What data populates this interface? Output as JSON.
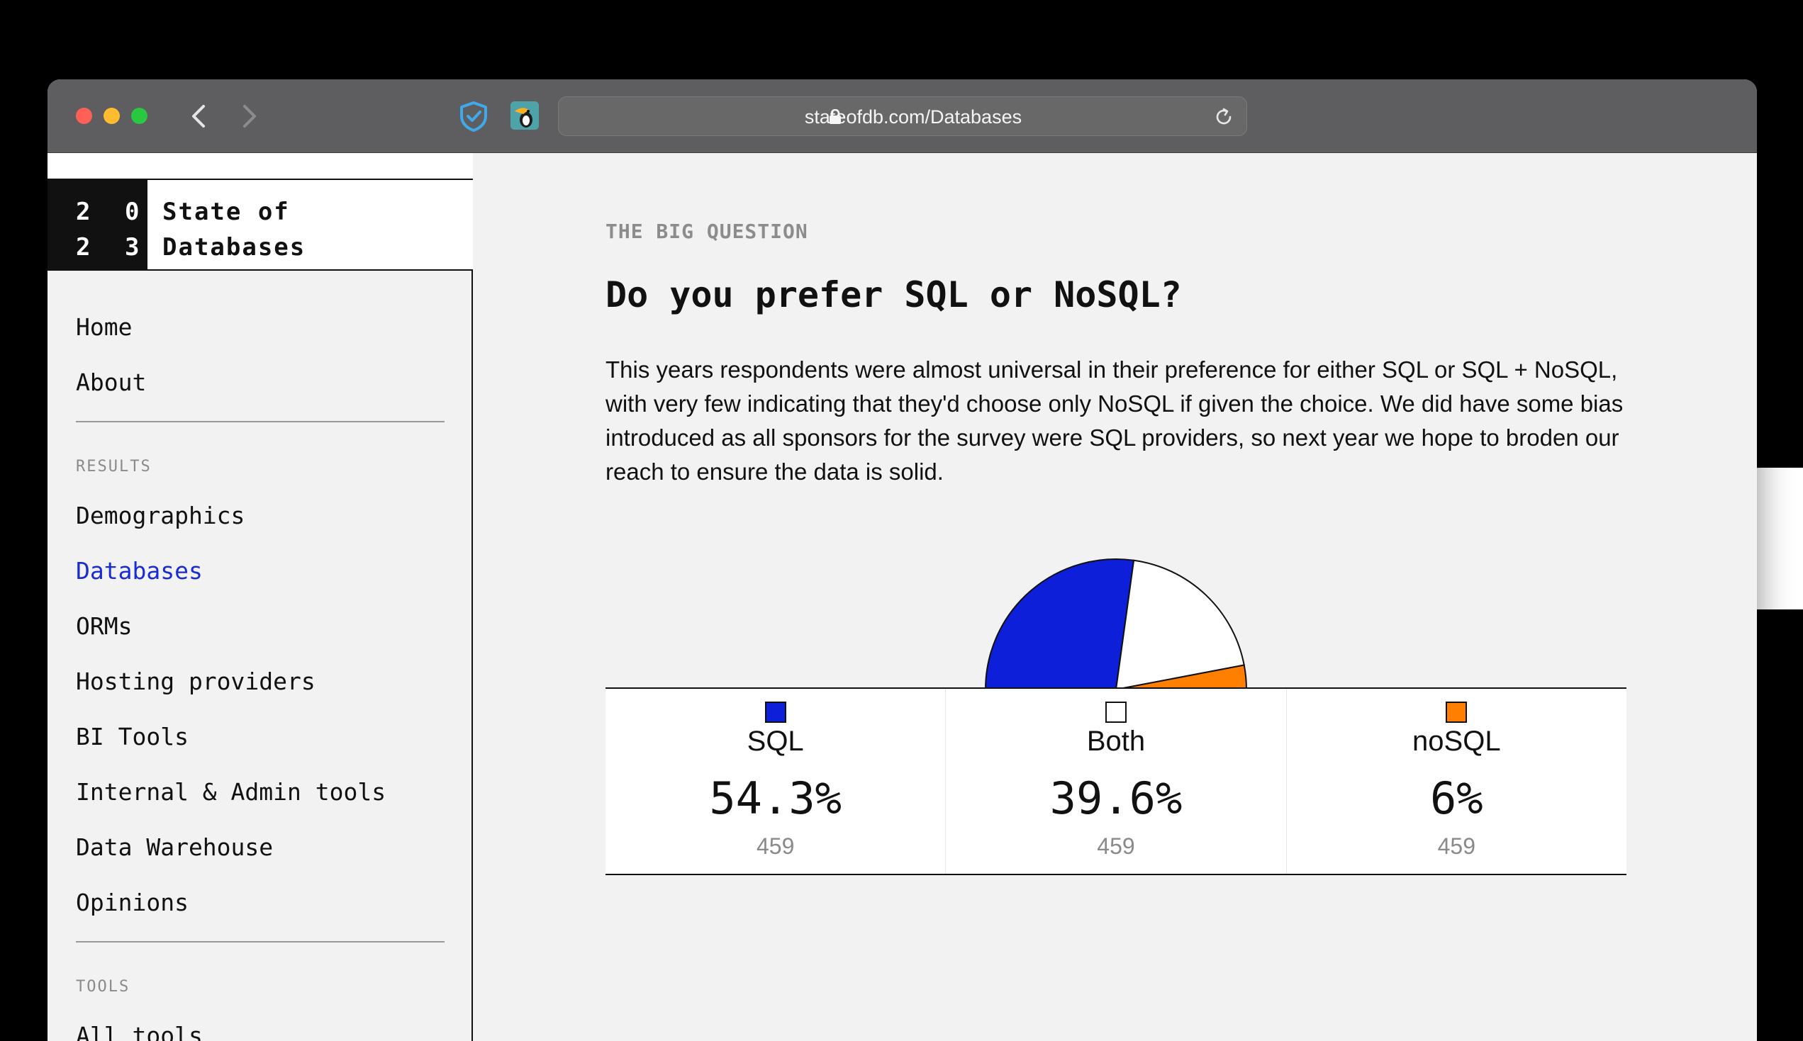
{
  "browser": {
    "url": "stateofdb.com/Databases",
    "icons": {
      "back": "chevron-left-icon",
      "forward": "chevron-right-icon",
      "shield": "shield-check-icon",
      "extension": "toucan-extension-icon",
      "lock": "lock-icon",
      "reload": "reload-icon"
    }
  },
  "brand": {
    "year_line1": "2 0",
    "year_line2": "2 3",
    "title_line1": "State of",
    "title_line2": "Databases"
  },
  "sidebar": {
    "top_links": [
      "Home",
      "About"
    ],
    "results_heading": "RESULTS",
    "results_links": [
      "Demographics",
      "Databases",
      "ORMs",
      "Hosting providers",
      "BI Tools",
      "Internal & Admin tools",
      "Data Warehouse",
      "Opinions"
    ],
    "active_link": "Databases",
    "tools_heading": "TOOLS",
    "tools_links": [
      "All tools"
    ]
  },
  "main": {
    "eyebrow": "THE BIG QUESTION",
    "heading": "Do you prefer SQL or NoSQL?",
    "paragraph": "This years respondents were almost universal in their preference for either SQL or SQL + NoSQL, with very few indicating that they'd choose only NoSQL if given the choice. We did have some bias introduced as all sponsors for the survey were SQL providers, so next year we hope to broden our reach to ensure the data is solid."
  },
  "chart_data": {
    "type": "pie",
    "categories": [
      "SQL",
      "Both",
      "noSQL"
    ],
    "values": [
      54.3,
      39.6,
      6
    ],
    "value_labels": [
      "54.3%",
      "39.6%",
      "6%"
    ],
    "counts": [
      "459",
      "459",
      "459"
    ],
    "colors": [
      "#0d1fd8",
      "#ffffff",
      "#ff7f00"
    ],
    "shape": "half-pie"
  }
}
